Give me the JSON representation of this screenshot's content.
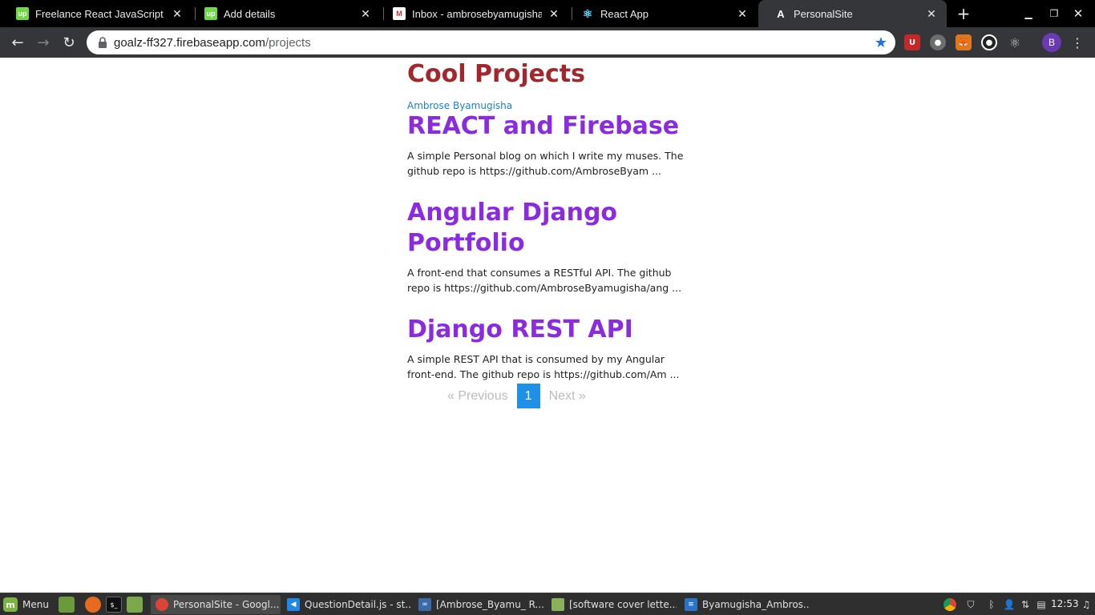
{
  "browser": {
    "tabs": [
      {
        "title": "Freelance React JavaScript Jobs",
        "icon": "upwork-icon",
        "color": "#6fda44",
        "glyph": "up"
      },
      {
        "title": "Add details",
        "icon": "upwork-icon",
        "color": "#6fda44",
        "glyph": "up"
      },
      {
        "title": "Inbox - ambrosebyamugisha@",
        "icon": "gmail-icon",
        "color": "#ffffff",
        "glyph": "M"
      },
      {
        "title": "React App",
        "icon": "react-icon",
        "color": "#61dafb",
        "glyph": "⚛"
      },
      {
        "title": "PersonalSite",
        "icon": "angular-icon",
        "color": "#000000",
        "glyph": "A"
      }
    ],
    "url_host": "goalz-ff327.firebaseapp.com",
    "url_path": "/projects",
    "profile_initial": "B"
  },
  "page": {
    "title": "Cool Projects",
    "author": "Ambrose Byamugisha",
    "projects": [
      {
        "title": "REACT and Firebase",
        "description": "A simple Personal blog on which I write my muses. The github repo is https://github.com/AmbroseByam ..."
      },
      {
        "title": "Angular Django Portfolio",
        "description": "A front-end that consumes a RESTful API. The github repo is https://github.com/AmbroseByamugisha/ang ..."
      },
      {
        "title": "Django REST API",
        "description": "A simple REST API that is consumed by my Angular front-end. The github repo is https://github.com/Am ..."
      }
    ],
    "pagination": {
      "previous": "«  Previous",
      "current": "1",
      "next": "Next  »"
    }
  },
  "taskbar": {
    "menu_label": "Menu",
    "windows": [
      {
        "title": "PersonalSite - Googl...",
        "icon": "chrome-icon"
      },
      {
        "title": "QuestionDetail.js - st...",
        "icon": "vscode-icon"
      },
      {
        "title": "[Ambrose_Byamu_ R...",
        "icon": "app-icon"
      },
      {
        "title": "[software cover lette...",
        "icon": "folder-icon"
      },
      {
        "title": "Byamugisha_Ambros...",
        "icon": "document-icon"
      }
    ],
    "clock": "12:53"
  }
}
